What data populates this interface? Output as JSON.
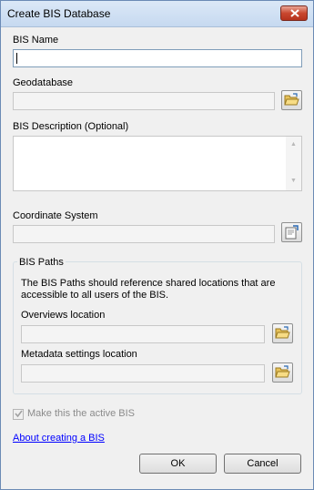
{
  "window": {
    "title": "Create BIS Database"
  },
  "bis_name": {
    "label": "BIS Name",
    "value": ""
  },
  "geodatabase": {
    "label": "Geodatabase",
    "value": ""
  },
  "description": {
    "label": "BIS Description (Optional)",
    "value": ""
  },
  "coordinate_system": {
    "label": "Coordinate System",
    "value": ""
  },
  "bis_paths": {
    "group_title": "BIS Paths",
    "description": "The BIS Paths should reference shared locations that are accessible to all users of the BIS.",
    "overviews": {
      "label": "Overviews location",
      "value": ""
    },
    "metadata": {
      "label": "Metadata settings location",
      "value": ""
    }
  },
  "active_bis": {
    "label": "Make this the active BIS",
    "checked": true,
    "enabled": false
  },
  "help_link": "About creating a BIS",
  "buttons": {
    "ok": "OK",
    "cancel": "Cancel"
  },
  "colors": {
    "link": "#0000ff",
    "close_button": "#c9472f",
    "title_bar": "#c6d9f0"
  },
  "icons": {
    "browse": "open-folder-icon",
    "coordinate_browse": "coordinate-system-icon",
    "close": "close-icon"
  }
}
